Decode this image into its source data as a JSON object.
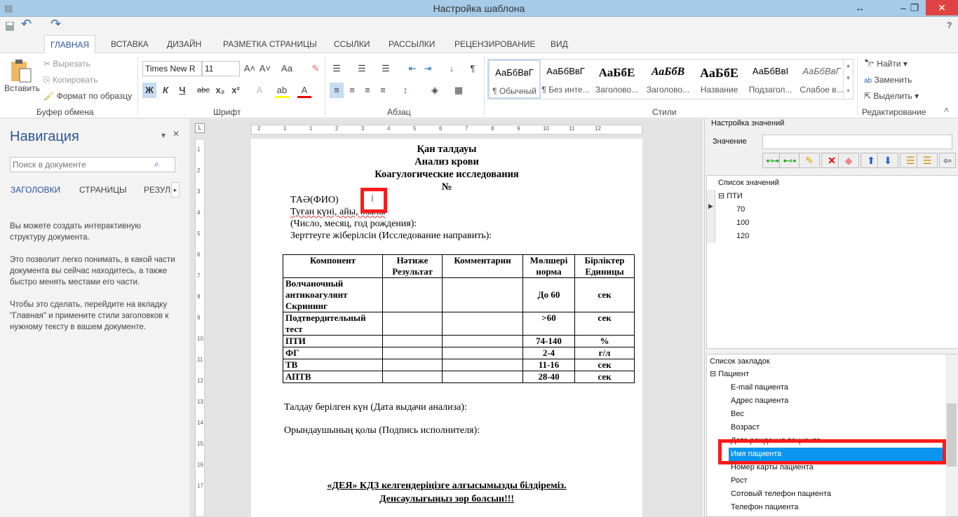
{
  "window": {
    "title": "Настройка шаблона",
    "resize_icon": "↔",
    "minimize": "–",
    "restore": "❐",
    "close": "✕",
    "help": "?"
  },
  "qat": {
    "save": "save-icon",
    "undo": "↶",
    "redo": "↷"
  },
  "tabs": [
    "ГЛАВНАЯ",
    "ВСТАВКА",
    "ДИЗАЙН",
    "РАЗМЕТКА СТРАНИЦЫ",
    "ССЫЛКИ",
    "РАССЫЛКИ",
    "РЕЦЕНЗИРОВАНИЕ",
    "ВИД"
  ],
  "clipboard": {
    "paste": "Вставить",
    "cut": "Вырезать",
    "copy": "Копировать",
    "format_painter": "Формат по образцу",
    "label": "Буфер обмена"
  },
  "font": {
    "name": "Times New R",
    "size": "11",
    "label": "Шрифт",
    "bold": "Ж",
    "italic": "К",
    "underline": "Ч",
    "strike": "abc",
    "sub": "x₂",
    "sup": "x²",
    "grow": "A˄",
    "shrink": "A˅",
    "case": "Aa",
    "clear": "✎"
  },
  "paragraph": {
    "label": "Абзац",
    "pilcrow": "¶"
  },
  "styles": {
    "label": "Стили",
    "items": [
      {
        "sample": "АаБбВвГ",
        "name": "¶ Обычный"
      },
      {
        "sample": "АаБбВвГ",
        "name": "¶ Без инте..."
      },
      {
        "sample": "АаБбЕ",
        "name": "Заголово..."
      },
      {
        "sample": "АаБбВ",
        "name": "Заголово..."
      },
      {
        "sample": "АаБбЕ",
        "name": "Название"
      },
      {
        "sample": "АаБбВвI",
        "name": "Подзагол..."
      },
      {
        "sample": "АаБбВвГ",
        "name": "Слабое в..."
      }
    ]
  },
  "editing": {
    "label": "Редактирование",
    "find": "Найти",
    "replace": "Заменить",
    "select": "Выделить"
  },
  "navigation": {
    "title": "Навигация",
    "search_placeholder": "Поиск в документе",
    "tabs": [
      "ЗАГОЛОВКИ",
      "СТРАНИЦЫ",
      "РЕЗУЛЬ"
    ],
    "help": [
      "Вы можете создать интерактивную структуру документа.",
      "Это позволит легко понимать, в какой части документа вы сейчас находитесь, а также быстро менять местами его части.",
      "Чтобы это сделать, перейдите на вкладку \"Главная\" и примените стили заголовков к нужному тексту в вашем документе."
    ]
  },
  "ruler": {
    "h": [
      "2",
      "1",
      "1",
      "2",
      "3",
      "4",
      "5",
      "6",
      "7",
      "8",
      "9",
      "10",
      "11",
      "12"
    ],
    "v": [
      "1",
      "2",
      "3",
      "4",
      "5",
      "6",
      "7",
      "8",
      "9",
      "10",
      "11",
      "12",
      "13",
      "14",
      "15",
      "16",
      "17"
    ]
  },
  "document": {
    "headings": [
      "Қан талдауы",
      "Анализ крови",
      "Коагулогические исследования",
      "№"
    ],
    "lines": [
      "ТАӘ(ФИО)",
      "Туған күні, айы, жылы",
      "(Число, месяц, год рождения):",
      "Зерттеуге жіберілсін (Исследование направить):"
    ],
    "table": {
      "headers": [
        "Компонент",
        "Нәтиже Результат",
        "Комментарии",
        "Мөлшері норма",
        "Бірліктер Единицы"
      ],
      "rows": [
        [
          "Волчаночный антикоагулянт Скрининг",
          "",
          "",
          "До 60",
          "сек"
        ],
        [
          "Подтвердительный тест",
          "",
          "",
          ">60",
          "сек"
        ],
        [
          "ПТИ",
          "",
          "",
          "74-140",
          "%"
        ],
        [
          "ФГ",
          "",
          "",
          "2-4",
          "г/л"
        ],
        [
          "ТВ",
          "",
          "",
          "11-16",
          "сек"
        ],
        [
          "АПТВ",
          "",
          "",
          "28-40",
          "сек"
        ]
      ]
    },
    "footer_lines": [
      "Талдау берілген күн (Дата выдачи анализа):",
      "Орындаушының қолы (Подпись исполнителя):"
    ],
    "closing": [
      "«ДЕЯ» КДЗ келгендеріңізге алғысымызды білдіреміз.",
      "Денсаулығыңыз зор болсын!!!"
    ]
  },
  "values_panel": {
    "title": "Настройка значений",
    "value_label": "Значение",
    "value": "",
    "list_title": "Список значений",
    "root": "ПТИ",
    "items": [
      "70",
      "100",
      "120"
    ]
  },
  "bookmarks": {
    "title": "Список закладок",
    "root": "Пациент",
    "items": [
      "E-mail пациента",
      "Адрес пациента",
      "Вес",
      "Возраст",
      "Дата рождения пациента",
      "Имя пациента",
      "Номер карты пациента",
      "Рост",
      "Сотовый телефон пациента",
      "Телефон пациента"
    ],
    "selected": "Имя пациента"
  },
  "colors": {
    "accent": "#2b579a",
    "titlebar": "#a6cbe8",
    "selection": "#0a96f0",
    "highlight_box": "#ff1a1a"
  }
}
